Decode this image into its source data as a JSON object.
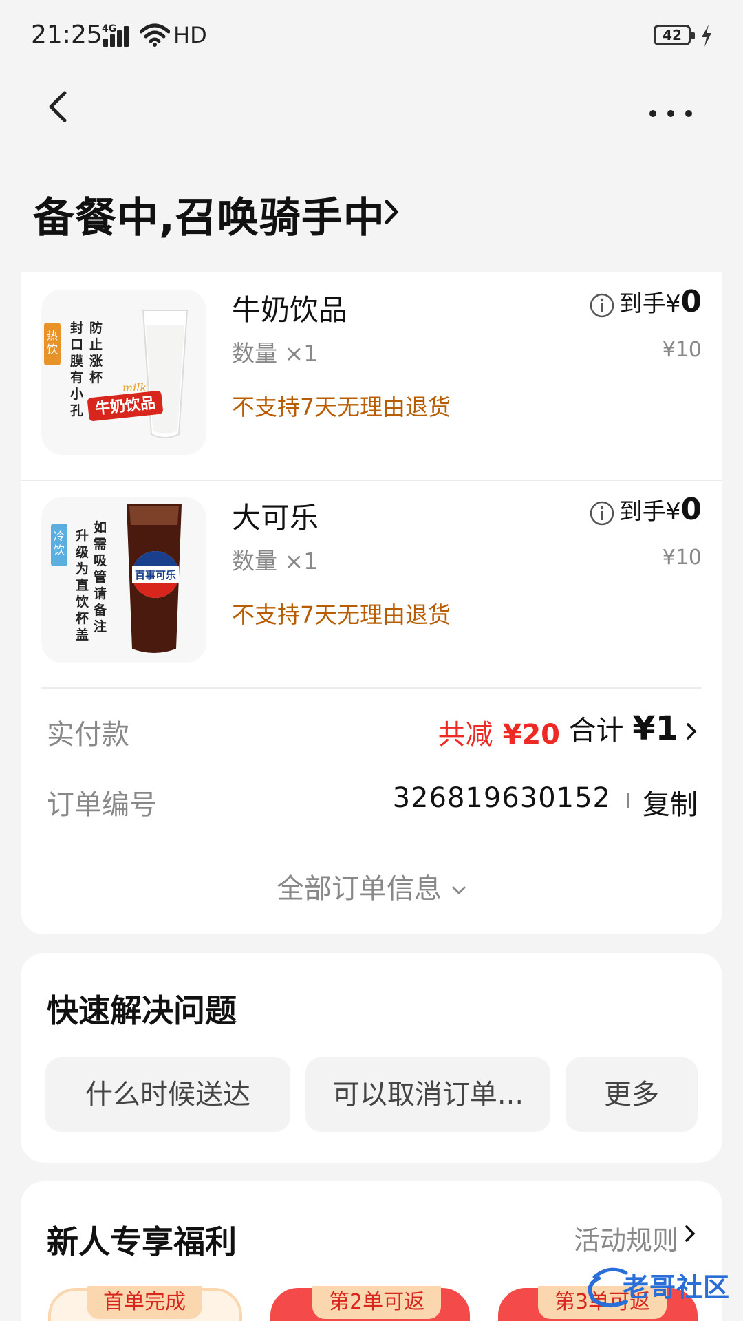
{
  "status_bar": {
    "time": "21:25",
    "network": "4G",
    "hd": "HD",
    "battery": "42"
  },
  "header": {
    "title": "备餐中,召唤骑手中"
  },
  "items": [
    {
      "name": "牛奶饮品",
      "quantity": "数量 ×1",
      "note": "不支持7天无理由退货",
      "pay_label": "到手¥",
      "pay_value": "0",
      "original_price": "¥10",
      "thumb_tag": "热饮",
      "thumb_lines": [
        "防止涨杯",
        "封口膜有小孔"
      ],
      "thumb_brand": "牛奶饮品",
      "thumb_brand_sub": "milk"
    },
    {
      "name": "大可乐",
      "quantity": "数量 ×1",
      "note": "不支持7天无理由退货",
      "pay_label": "到手¥",
      "pay_value": "0",
      "original_price": "¥10",
      "thumb_tag": "冷饮",
      "thumb_lines": [
        "如需吸管请备注",
        "升级为直饮杯盖"
      ],
      "thumb_brand": "百事可乐"
    }
  ],
  "payment": {
    "label": "实付款",
    "discount_label": "共减",
    "discount_value": "¥20",
    "total_label": "合计",
    "total_currency": "¥",
    "total_value": "1"
  },
  "order": {
    "label": "订单编号",
    "number": "326819630152",
    "copy_label": "复制"
  },
  "all_info_label": "全部订单信息",
  "quick": {
    "title": "快速解决问题",
    "chips": [
      "什么时候送达",
      "可以取消订单...",
      "更多"
    ]
  },
  "benefits": {
    "title": "新人专享福利",
    "rules_label": "活动规则",
    "coupons": [
      "首单完成",
      "第2单可返",
      "第3单可返"
    ]
  },
  "watermark": "老哥社区",
  "colors": {
    "accent_red": "#ee2a24",
    "warning_orange": "#b85c00",
    "background": "#f4f4f4"
  }
}
